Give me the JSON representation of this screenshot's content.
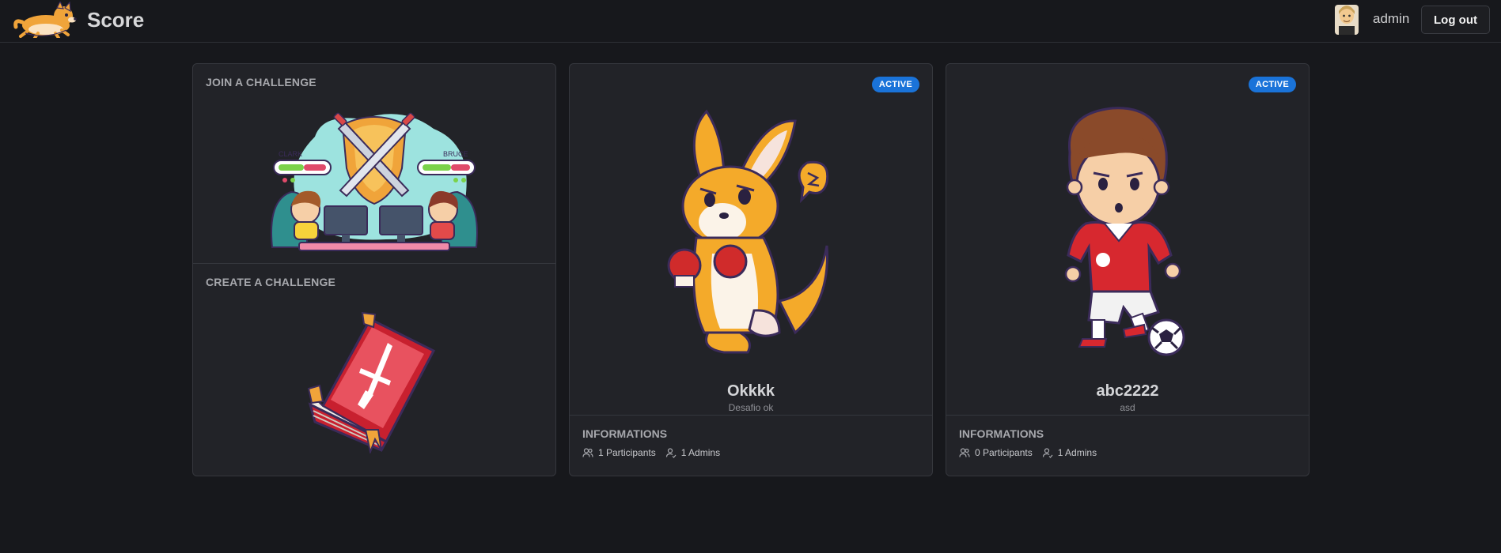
{
  "header": {
    "brand": "Score",
    "username": "admin",
    "logout_label": "Log out",
    "icons": [
      "corgi-logo-icon",
      "user-avatar"
    ]
  },
  "join": {
    "title": "JOIN A CHALLENGE",
    "illustration": "gaming-battle-illustration",
    "players": [
      "CLARK",
      "BRUCE"
    ]
  },
  "create": {
    "title": "CREATE A CHALLENGE",
    "illustration": "red-book-sword-illustration"
  },
  "challenges": [
    {
      "status": "ACTIVE",
      "name": "Okkkk",
      "description": "Desafio ok",
      "info_title": "INFORMATIONS",
      "participants": "1 Participants",
      "admins": "1 Admins",
      "illustration": "boxing-kangaroo-illustration"
    },
    {
      "status": "ACTIVE",
      "name": "abc2222",
      "description": "asd",
      "info_title": "INFORMATIONS",
      "participants": "0 Participants",
      "admins": "1 Admins",
      "illustration": "soccer-boy-illustration"
    }
  ],
  "colors": {
    "background": "#17181c",
    "card": "#222328",
    "border": "#35373d",
    "badge": "#1a73d9"
  }
}
